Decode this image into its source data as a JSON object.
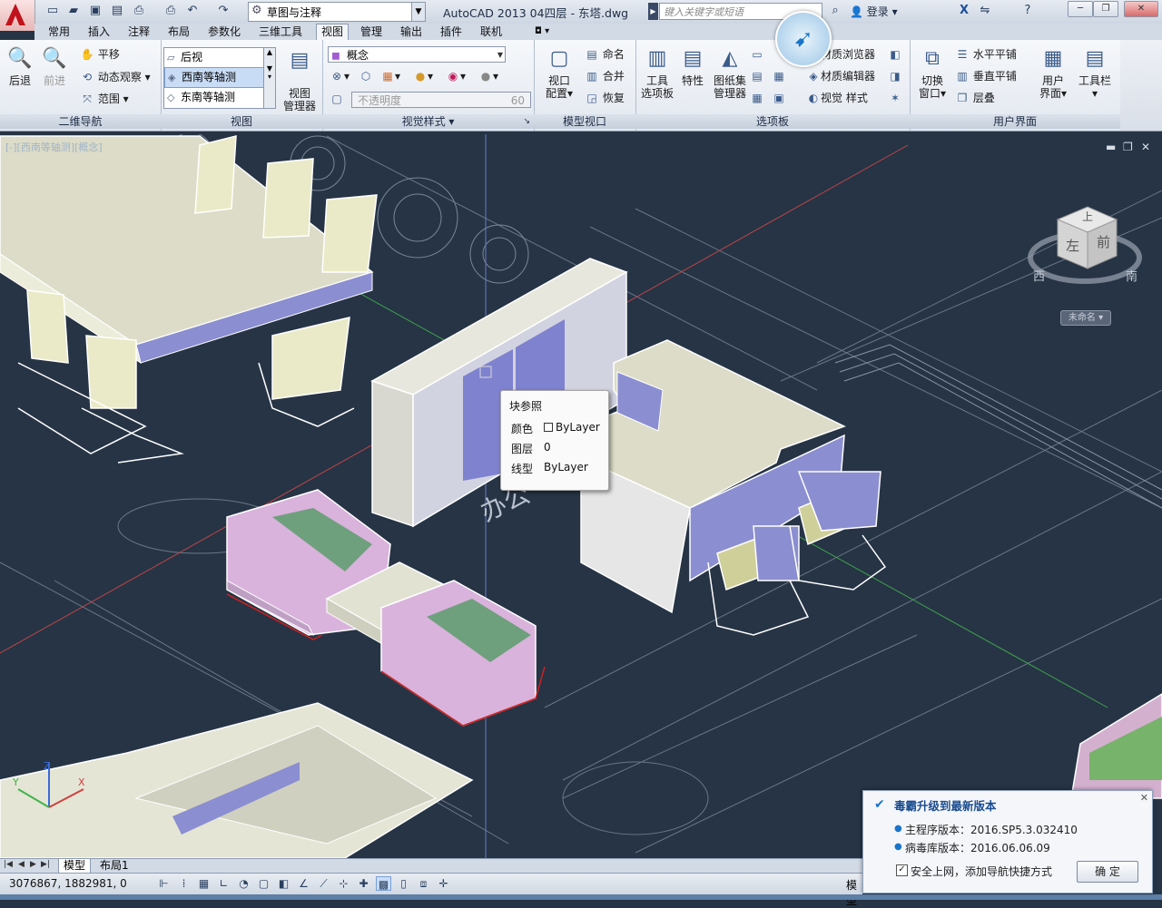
{
  "title_bar": {
    "workspace": "草图与注释",
    "doc_title": "AutoCAD 2013    04四层 - 东塔.dwg",
    "search_placeholder": "键入关键字或短语",
    "login": "登录",
    "window_buttons": [
      "─",
      "❐",
      "✕"
    ]
  },
  "tabs": [
    "常用",
    "插入",
    "注释",
    "布局",
    "参数化",
    "三维工具",
    "视图",
    "管理",
    "输出",
    "插件",
    "联机"
  ],
  "active_tab": "视图",
  "ribbon": {
    "nav2d": {
      "title": "二维导航",
      "back": "后退",
      "forward": "前进",
      "pan": "平移",
      "orbit": "动态观察",
      "extents": "范围"
    },
    "views": {
      "title": "视图",
      "items": [
        "后视",
        "西南等轴测",
        "东南等轴测"
      ],
      "selected": "西南等轴测",
      "manager_line1": "视图",
      "manager_line2": "管理器"
    },
    "visual_styles": {
      "title": "视觉样式",
      "style": "概念",
      "opacity_label": "不透明度",
      "opacity_value": "60"
    },
    "model_viewports": {
      "title": "模型视口",
      "config_line1": "视口",
      "config_line2": "配置",
      "named": "命名",
      "join": "合并",
      "restore": "恢复"
    },
    "palettes": {
      "title": "选项板",
      "tool_palettes_line1": "工具",
      "tool_palettes_line2": "选项板",
      "properties": "特性",
      "sheet_set_line1": "图纸集",
      "sheet_set_line2": "管理器",
      "mat_browser": "材质浏览器",
      "mat_editor": "材质编辑器",
      "visual_styles": "视觉 样式"
    },
    "user_interface": {
      "title": "用户界面",
      "switch_line1": "切换",
      "switch_line2": "窗口",
      "tile_h": "水平平铺",
      "tile_v": "垂直平铺",
      "cascade": "层叠",
      "ui_line1": "用户",
      "ui_line2": "界面",
      "toolbars": "工具栏"
    }
  },
  "viewport": {
    "label": "[-][西南等轴测][概念]",
    "controls": [
      "▬",
      "❐",
      "✕"
    ],
    "viewcube": {
      "top": "上",
      "left": "左",
      "front": "前",
      "west": "西",
      "south": "南",
      "unnamed": "未命名"
    }
  },
  "tooltip": {
    "heading": "块参照",
    "rows": [
      {
        "key": "颜色",
        "value": "ByLayer"
      },
      {
        "key": "图层",
        "value": "0"
      },
      {
        "key": "线型",
        "value": "ByLayer"
      }
    ]
  },
  "layout_tabs": {
    "model": "模型",
    "layout1": "布局1"
  },
  "status": {
    "coords": "3076867,  1882981,  0",
    "model_label": "模型"
  },
  "notification": {
    "title": "毒霸升级到最新版本",
    "main_version": "主程序版本：2016.SP5.3.032410",
    "virus_db": "病毒库版本：2016.06.06.09",
    "checkbox": "安全上网，添加导航快捷方式",
    "ok": "确 定"
  },
  "colors": {
    "accent": "#1a74c9",
    "drawing_bg": "#263445",
    "autocad_red": "#c0121b"
  }
}
